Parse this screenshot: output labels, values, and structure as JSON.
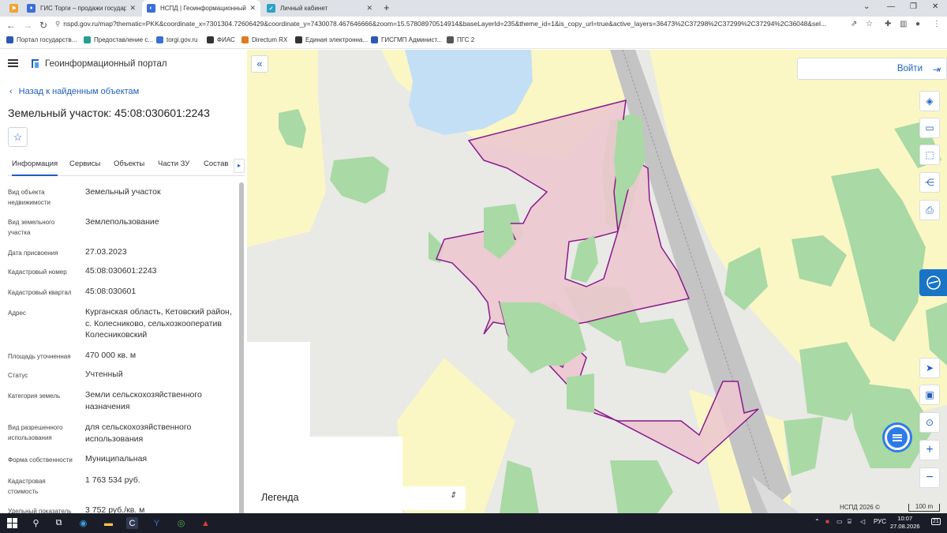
{
  "browser": {
    "tabs": [
      {
        "title": "ГИС Торги – продажи государс",
        "color": "#f0a330"
      },
      {
        "title": "НСПД | Геоинформационный г",
        "color": "#3b6fd8"
      },
      {
        "title": "Личный кабинет",
        "color": "#2aa3c7"
      }
    ],
    "url": "nspd.gov.ru/map?thematic=PKK&coordinate_x=7301304.72606429&coordinate_y=7430078.467646666&zoom=15.57808970514914&baseLayerId=235&theme_id=1&is_copy_url=true&active_layers=36473%2C37298%2C37299%2C37294%2C36048&sel...",
    "bookmarks": [
      {
        "label": "Портал государств...",
        "color": "#2c58b4"
      },
      {
        "label": "Предоставление с...",
        "color": "#2a9d8f"
      },
      {
        "label": "torgi.gov.ru",
        "color": "#3b6fd8"
      },
      {
        "label": "ФИАС",
        "color": "#333"
      },
      {
        "label": "Directum RX",
        "color": "#e07b22"
      },
      {
        "label": "Единая электронна...",
        "color": "#333"
      },
      {
        "label": "ГИСГМП Админист...",
        "color": "#2c58b4"
      },
      {
        "label": "ПГС 2",
        "color": "#555"
      }
    ]
  },
  "panel": {
    "app_title": "Геоинформационный портал",
    "back_label": "Назад к найденным объектам",
    "object_title": "Земельный участок: 45:08:030601:2243",
    "tabs": [
      "Информация",
      "Сервисы",
      "Объекты",
      "Части ЗУ",
      "Состав"
    ],
    "properties": [
      {
        "label": "Вид объекта недвижимости",
        "value": "Земельный участок"
      },
      {
        "label": "Вид земельного участка",
        "value": "Землепользование"
      },
      {
        "label": "Дата присвоения",
        "value": "27.03.2023"
      },
      {
        "label": "Кадастровый номер",
        "value": "45:08:030601:2243"
      },
      {
        "label": "Кадастровый квартал",
        "value": "45:08:030601"
      },
      {
        "label": "Адрес",
        "value": "Курганская область, Кетовский район, с. Колесниково, сельхозкооператив Колесниковский"
      },
      {
        "label": "Площадь уточненная",
        "value": "470 000 кв. м"
      },
      {
        "label": "Статус",
        "value": "Учтенный"
      },
      {
        "label": "Категория земель",
        "value": "Земли сельскохозяйственного назначения"
      },
      {
        "label": "Вид разрешенного использования",
        "value": "для сельскохозяйственного использования"
      },
      {
        "label": "Форма собственности",
        "value": "Муниципальная"
      },
      {
        "label": "Кадастровая стоимость",
        "value": "1 763 534 руб."
      },
      {
        "label": "Удельный показатель",
        "value": "3 752 руб./кв. м"
      }
    ]
  },
  "map": {
    "login_label": "Войти",
    "legend_label": "Легенда",
    "copyright": "НСПД 2026 ©",
    "scale_label": "100 m",
    "colors": {
      "background": "#e9e9e6",
      "field": "#fbf7c4",
      "forest": "#a9d9a5",
      "water": "#c3dff6",
      "parcel_fill": "#ecc8cf",
      "parcel_border": "#8a1a8c",
      "road": "#c4c4c4"
    }
  },
  "taskbar": {
    "lang": "РУС",
    "time": "10:07",
    "date": "27.08.2026",
    "notifications": "21"
  }
}
